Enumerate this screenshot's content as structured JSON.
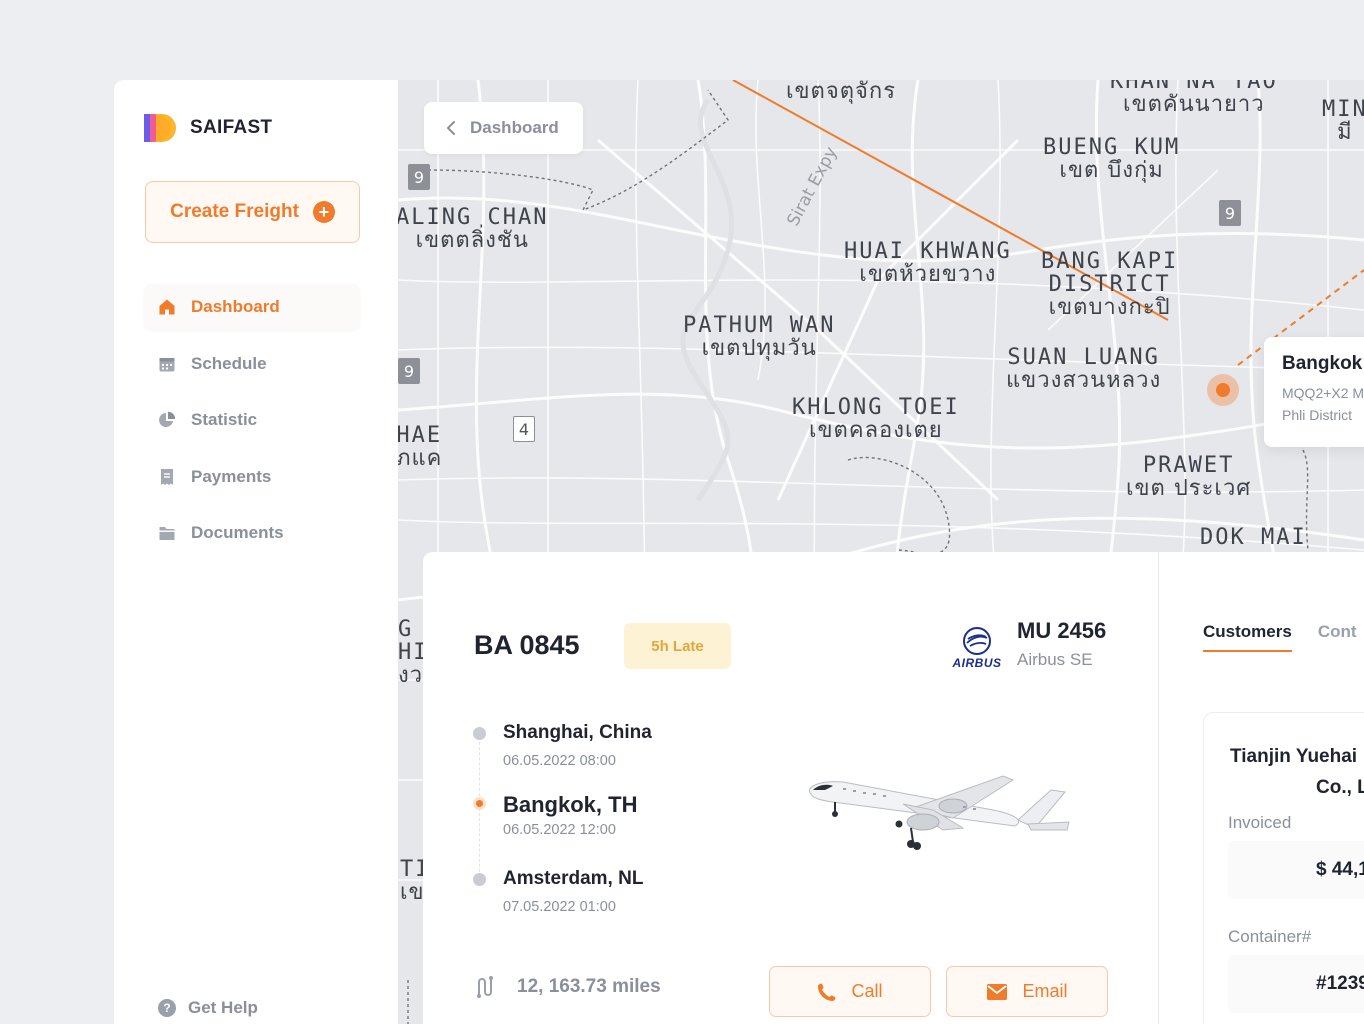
{
  "brand": {
    "name": "SAIFAST"
  },
  "sidebar": {
    "create_label": "Create Freight",
    "items": [
      {
        "label": "Dashboard",
        "icon": "home-icon",
        "active": true
      },
      {
        "label": "Schedule",
        "icon": "calendar-icon",
        "active": false
      },
      {
        "label": "Statistic",
        "icon": "pie-chart-icon",
        "active": false
      },
      {
        "label": "Payments",
        "icon": "receipt-icon",
        "active": false
      },
      {
        "label": "Documents",
        "icon": "folder-icon",
        "active": false
      }
    ],
    "help_label": "Get Help"
  },
  "map": {
    "back_label": "Dashboard",
    "labels": {
      "chatuchak_th": "เขตจตุจักร",
      "khan_na_yao_en": "KHAN NA YAO",
      "khan_na_yao_th": "เขตคันนายาว",
      "min_en": "MIN",
      "min_th": "มี",
      "bueng_kum_en": "BUENG KUM",
      "bueng_kum_th": "เขต บึงกุ่ม",
      "taling_chan_en": "ALING CHAN",
      "taling_chan_th": "เขตตลิ่งชัน",
      "sirat_expy": "Sirat Expy",
      "huai_khwang_en": "HUAI KHWANG",
      "huai_khwang_th": "เขตห้วยขวาง",
      "bang_kapi_en": "BANG KAPI",
      "bang_kapi_en2": "DISTRICT",
      "bang_kapi_th": "เขตบางกะปิ",
      "pathum_wan_en": "PATHUM WAN",
      "pathum_wan_th": "เขตปทุมวัน",
      "suan_luang_en": "SUAN LUANG",
      "suan_luang_th": "แขวงสวนหลวง",
      "khlong_toei_en": "KHLONG TOEI",
      "khlong_toei_th": "เขตคลองเตย",
      "phasi_en": "HAE",
      "phasi_th": "ภแค",
      "prawet_en": "PRAWET",
      "prawet_th": "เขต ประเวศ",
      "dok_mai_en": "DOK MAI",
      "g_en": "G",
      "hi_en": "HI",
      "th_frag": "งว",
      "ti_en": "TI",
      "ti_th": "เข"
    },
    "shields": [
      "9",
      "9",
      "9",
      "4"
    ],
    "popup": {
      "title": "Bangkok",
      "line1": "MQQ2+X2 M",
      "line2": "Phli District"
    },
    "route_color": "#f07b2a"
  },
  "flight": {
    "number": "BA 0845",
    "status_badge": "5h Late",
    "airline_code": "MU 2456",
    "airline_name": "Airbus SE",
    "airline_logo_text": "AIRBUS",
    "stops": [
      {
        "city": "Shanghai, China",
        "time": "06.05.2022 08:00",
        "state": "done"
      },
      {
        "city": "Bangkok, TH",
        "time": "06.05.2022 12:00",
        "state": "current"
      },
      {
        "city": "Amsterdam, NL",
        "time": "07.05.2022 01:00",
        "state": "upcoming"
      }
    ],
    "distance": "12, 163.73 miles",
    "call_label": "Call",
    "email_label": "Email"
  },
  "customers": {
    "tabs": [
      {
        "label": "Customers",
        "active": true
      },
      {
        "label": "Cont",
        "active": false
      }
    ],
    "card": {
      "name_line1": "Tianjin Yuehai",
      "name_line2": "Co., L",
      "invoiced_label": "Invoiced",
      "invoiced_value": "$ 44,1",
      "container_label": "Container#",
      "container_value": "#1239"
    }
  },
  "colors": {
    "accent": "#f07b2a",
    "badge_bg": "#fdf3d4",
    "badge_text": "#e2a73a"
  }
}
